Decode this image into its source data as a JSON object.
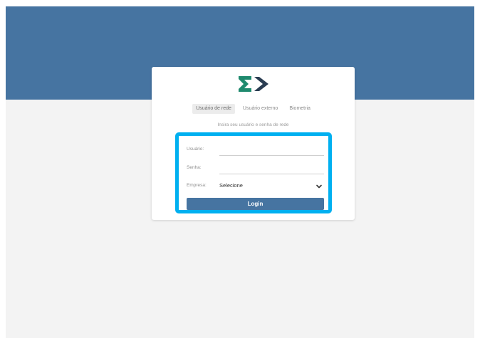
{
  "tabs": [
    {
      "label": "Usuário de rede",
      "active": true
    },
    {
      "label": "Usuário externo",
      "active": false
    },
    {
      "label": "Biometria",
      "active": false
    }
  ],
  "hint": "Insira seu usuário e senha de rede",
  "form": {
    "user_label": "Usuário:",
    "password_label": "Senha:",
    "company_label": "Empresa:",
    "company_selected": "Selecione",
    "login_label": "Login"
  },
  "colors": {
    "header_band": "#4674a1",
    "logo_sigma": "#1f8a6e",
    "logo_arrow": "#2a3d52",
    "highlight_border": "#00b0f0",
    "button": "#4674a1",
    "background": "#f3f3f3"
  },
  "icons": {
    "logo": "sigma-arrow-logo",
    "company_dropdown": "chevron-down-icon"
  }
}
